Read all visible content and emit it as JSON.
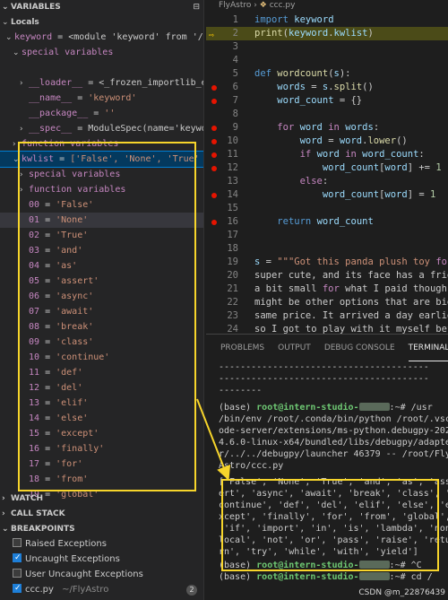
{
  "colors": {
    "highlight": "#f7d52b",
    "breakpoint": "#e51400",
    "prompt_user": "#6ec873",
    "background": "#1e1e1e"
  },
  "left": {
    "variables_header": "VARIABLES",
    "locals_label": "Locals",
    "rows": [
      {
        "indent": 1,
        "chev": "⌄",
        "key": "keyword",
        "eq": " = ",
        "val": "<module 'keyword' from '/r…"
      },
      {
        "indent": 2,
        "chev": "⌄",
        "key": "special variables",
        "eq": "",
        "val": ""
      },
      {
        "indent": 3,
        "chev": "",
        "key": "",
        "eq": "",
        "val": ""
      },
      {
        "indent": 3,
        "chev": "›",
        "key": "__loader__",
        "eq": " = ",
        "val": "<_frozen_importlib_e…"
      },
      {
        "indent": 3,
        "chev": "",
        "key": "__name__",
        "eq": " = ",
        "val": "'keyword'"
      },
      {
        "indent": 3,
        "chev": "",
        "key": "__package__",
        "eq": " = ",
        "val": "''"
      },
      {
        "indent": 3,
        "chev": "›",
        "key": "__spec__",
        "eq": " = ",
        "val": "ModuleSpec(name='keywo…"
      },
      {
        "indent": 2,
        "chev": "›",
        "key": "function variables",
        "eq": "",
        "val": ""
      },
      {
        "indent": 2,
        "chev": "⌄",
        "key": "kwlist",
        "eq": " = ",
        "val": "['False', 'None', 'True' …"
      },
      {
        "indent": 3,
        "chev": "›",
        "key": "special variables",
        "eq": "",
        "val": ""
      },
      {
        "indent": 3,
        "chev": "›",
        "key": "function variables",
        "eq": "",
        "val": ""
      },
      {
        "indent": 3,
        "chev": "",
        "key": "00",
        "eq": " = ",
        "val": "'False'"
      },
      {
        "indent": 3,
        "chev": "",
        "key": "01",
        "eq": " = ",
        "val": "'None'"
      },
      {
        "indent": 3,
        "chev": "",
        "key": "02",
        "eq": " = ",
        "val": "'True'"
      },
      {
        "indent": 3,
        "chev": "",
        "key": "03",
        "eq": " = ",
        "val": "'and'"
      },
      {
        "indent": 3,
        "chev": "",
        "key": "04",
        "eq": " = ",
        "val": "'as'"
      },
      {
        "indent": 3,
        "chev": "",
        "key": "05",
        "eq": " = ",
        "val": "'assert'"
      },
      {
        "indent": 3,
        "chev": "",
        "key": "06",
        "eq": " = ",
        "val": "'async'"
      },
      {
        "indent": 3,
        "chev": "",
        "key": "07",
        "eq": " = ",
        "val": "'await'"
      },
      {
        "indent": 3,
        "chev": "",
        "key": "08",
        "eq": " = ",
        "val": "'break'"
      },
      {
        "indent": 3,
        "chev": "",
        "key": "09",
        "eq": " = ",
        "val": "'class'"
      },
      {
        "indent": 3,
        "chev": "",
        "key": "10",
        "eq": " = ",
        "val": "'continue'"
      },
      {
        "indent": 3,
        "chev": "",
        "key": "11",
        "eq": " = ",
        "val": "'def'"
      },
      {
        "indent": 3,
        "chev": "",
        "key": "12",
        "eq": " = ",
        "val": "'del'"
      },
      {
        "indent": 3,
        "chev": "",
        "key": "13",
        "eq": " = ",
        "val": "'elif'"
      },
      {
        "indent": 3,
        "chev": "",
        "key": "14",
        "eq": " = ",
        "val": "'else'"
      },
      {
        "indent": 3,
        "chev": "",
        "key": "15",
        "eq": " = ",
        "val": "'except'"
      },
      {
        "indent": 3,
        "chev": "",
        "key": "16",
        "eq": " = ",
        "val": "'finally'"
      },
      {
        "indent": 3,
        "chev": "",
        "key": "17",
        "eq": " = ",
        "val": "'for'"
      },
      {
        "indent": 3,
        "chev": "",
        "key": "18",
        "eq": " = ",
        "val": "'from'"
      },
      {
        "indent": 3,
        "chev": "",
        "key": "19",
        "eq": " = ",
        "val": "'global'"
      }
    ],
    "watch_header": "WATCH",
    "callstack_header": "CALL STACK",
    "breakpoints_header": "BREAKPOINTS",
    "breakpoints": [
      {
        "label": "Raised Exceptions",
        "checked": false
      },
      {
        "label": "Uncaught Exceptions",
        "checked": true
      },
      {
        "label": "User Uncaught Exceptions",
        "checked": false
      }
    ],
    "file_bp": {
      "label": "ccc.py",
      "path": "~/FlyAstro",
      "count": "2"
    }
  },
  "editor": {
    "breadcrumb": [
      "FlyAstro",
      "ccc.py"
    ],
    "lines": [
      {
        "n": "1",
        "t": "import keyword"
      },
      {
        "n": "2",
        "t": "print(keyword.kwlist)"
      },
      {
        "n": "3",
        "t": ""
      },
      {
        "n": "4",
        "t": ""
      },
      {
        "n": "5",
        "t": "def wordcount(s):"
      },
      {
        "n": "6",
        "t": "    words = s.split()"
      },
      {
        "n": "7",
        "t": "    word_count = {}"
      },
      {
        "n": "8",
        "t": ""
      },
      {
        "n": "9",
        "t": "    for word in words:"
      },
      {
        "n": "10",
        "t": "        word = word.lower()"
      },
      {
        "n": "11",
        "t": "        if word in word_count:"
      },
      {
        "n": "12",
        "t": "            word_count[word] += 1"
      },
      {
        "n": "13",
        "t": "        else:"
      },
      {
        "n": "14",
        "t": "            word_count[word] = 1"
      },
      {
        "n": "15",
        "t": ""
      },
      {
        "n": "16",
        "t": "    return word_count"
      },
      {
        "n": "17",
        "t": ""
      },
      {
        "n": "18",
        "t": ""
      },
      {
        "n": "19",
        "t": "s = \"\"\"Got this panda plush toy for"
      },
      {
        "n": "20",
        "t": "super cute, and its face has a frien"
      },
      {
        "n": "21",
        "t": "a bit small for what I paid though."
      },
      {
        "n": "22",
        "t": "might be other options that are bigg"
      },
      {
        "n": "23",
        "t": "same price. It arrived a day earlier"
      },
      {
        "n": "24",
        "t": "so I got to play with it myself befo"
      }
    ]
  },
  "panel": {
    "tabs": [
      "PROBLEMS",
      "OUTPUT",
      "DEBUG CONSOLE",
      "TERMINAL"
    ],
    "dashes": "---------------------------------------",
    "dashes_short": "--------",
    "term": [
      "(base) root@intern-studio-",
      ":~# /usr",
      "/bin/env /root/.conda/bin/python /root/.vsc",
      "ode-server/extensions/ms-python.debugpy-202",
      "4.6.0-linux-x64/bundled/libs/debugpy/adapte",
      "r/../../debugpy/launcher 46379 -- /root/Fly",
      "Astro/ccc.py"
    ],
    "output": [
      "['False', 'None', 'True', 'and', 'as', 'ass",
      "ert', 'async', 'await', 'break', 'class', '",
      "continue', 'def', 'del', 'elif', 'else', 'e",
      "xcept', 'finally', 'for', 'from', 'global',",
      " 'if', 'import', 'in', 'is', 'lambda', 'non",
      "local', 'not', 'or', 'pass', 'raise', 'retu",
      "rn', 'try', 'while', 'with', 'yield']"
    ],
    "after": [
      ":~# ^C",
      ":~# cd /"
    ],
    "prompt_prefix": "(base) ",
    "prompt_user": "root@intern-studio-",
    "watermark": "CSDN @m_22876439"
  }
}
